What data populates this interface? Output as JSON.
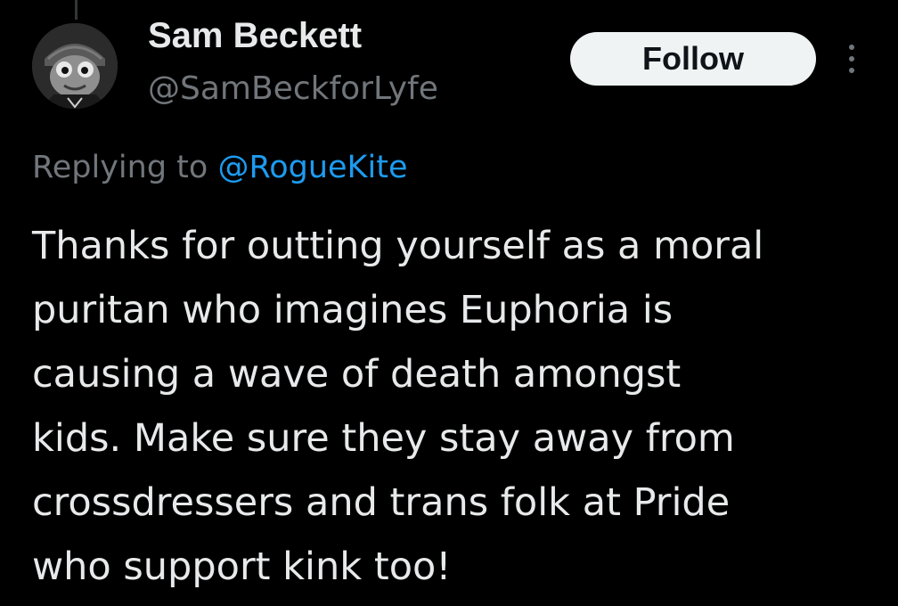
{
  "author": {
    "display_name": "Sam Beckett",
    "handle": "@SamBeckforLyfe",
    "avatar_icon": "profile-avatar"
  },
  "actions": {
    "follow_label": "Follow",
    "more_icon": "more-vertical-icon"
  },
  "reply": {
    "prefix": "Replying to",
    "mention": "@RogueKite"
  },
  "tweet": {
    "lines": [
      "Thanks for outting yourself as a moral",
      "puritan who imagines Euphoria is",
      "causing a wave of death amongst",
      "kids. Make sure they stay away from",
      "crossdressers and trans folk at Pride",
      "who support kink too!"
    ]
  },
  "colors": {
    "background": "#000000",
    "primary_text": "#e7e9ea",
    "secondary_text": "#71767b",
    "link": "#1d9bf0",
    "follow_bg": "#eff3f4",
    "follow_text": "#0f1419"
  }
}
